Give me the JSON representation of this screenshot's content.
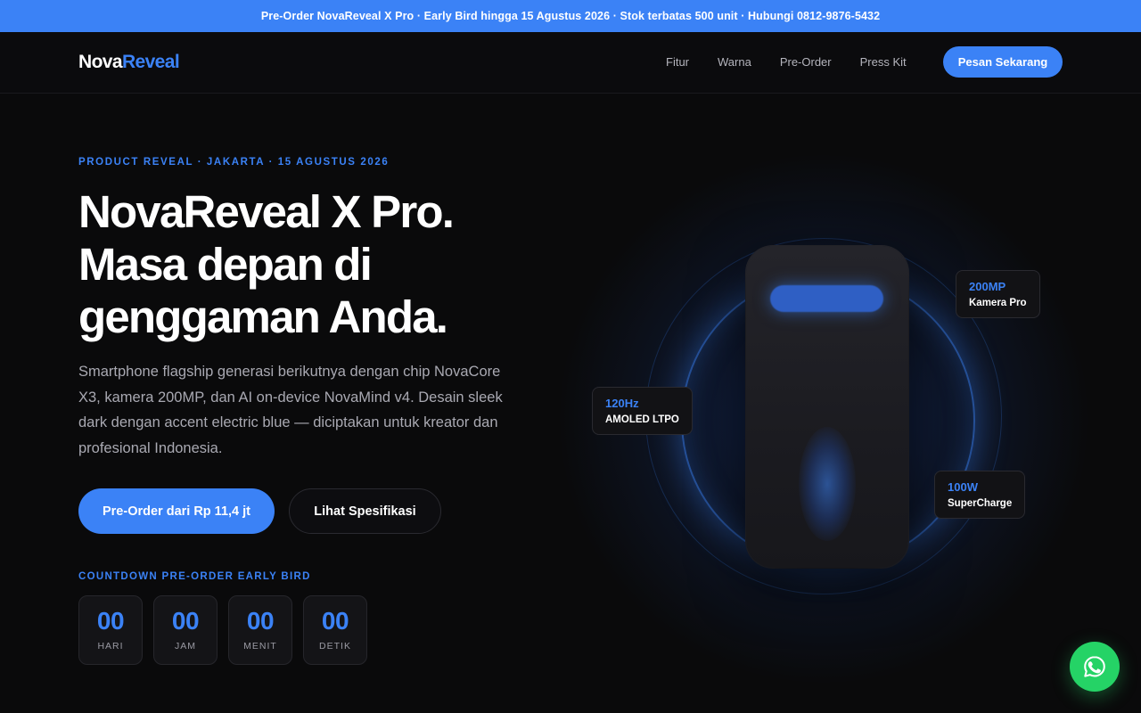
{
  "announcement": {
    "text": "Pre-Order NovaReveal X Pro · Early Bird hingga 15 Agustus 2026 · Stok terbatas 500 unit · Hubungi 0812-9876-5432"
  },
  "nav": {
    "logo_part1": "Nova",
    "logo_part2": "Reveal",
    "links": [
      "Fitur",
      "Warna",
      "Pre-Order",
      "Press Kit"
    ],
    "cta": "Pesan Sekarang"
  },
  "hero": {
    "eyebrow": "PRODUCT REVEAL · JAKARTA · 15 AGUSTUS 2026",
    "headline_lines": [
      "NovaReveal X Pro.",
      "Masa depan di",
      "genggaman Anda."
    ],
    "description": "Smartphone flagship generasi berikutnya dengan chip NovaCore X3, kamera 200MP, dan AI on-device NovaMind v4. Desain sleek dark dengan accent electric blue — diciptakan untuk kreator dan profesional Indonesia.",
    "primary_button": "Pre-Order dari Rp 11,4 jt",
    "secondary_button": "Lihat Spesifikasi"
  },
  "countdown": {
    "label": "COUNTDOWN PRE-ORDER EARLY BIRD",
    "units": [
      {
        "value": "00",
        "label": "HARI"
      },
      {
        "value": "00",
        "label": "JAM"
      },
      {
        "value": "00",
        "label": "MENIT"
      },
      {
        "value": "00",
        "label": "DETIK"
      }
    ]
  },
  "badges": {
    "camera": {
      "value": "200MP",
      "label": "Kamera Pro"
    },
    "display": {
      "value": "120Hz",
      "label": "AMOLED LTPO"
    },
    "charge": {
      "value": "100W",
      "label": "SuperCharge"
    }
  },
  "colors": {
    "accent": "#3b82f6",
    "background": "#0a0a0b",
    "whatsapp": "#25d366"
  },
  "icons": {
    "floating_button": "whatsapp-icon"
  }
}
